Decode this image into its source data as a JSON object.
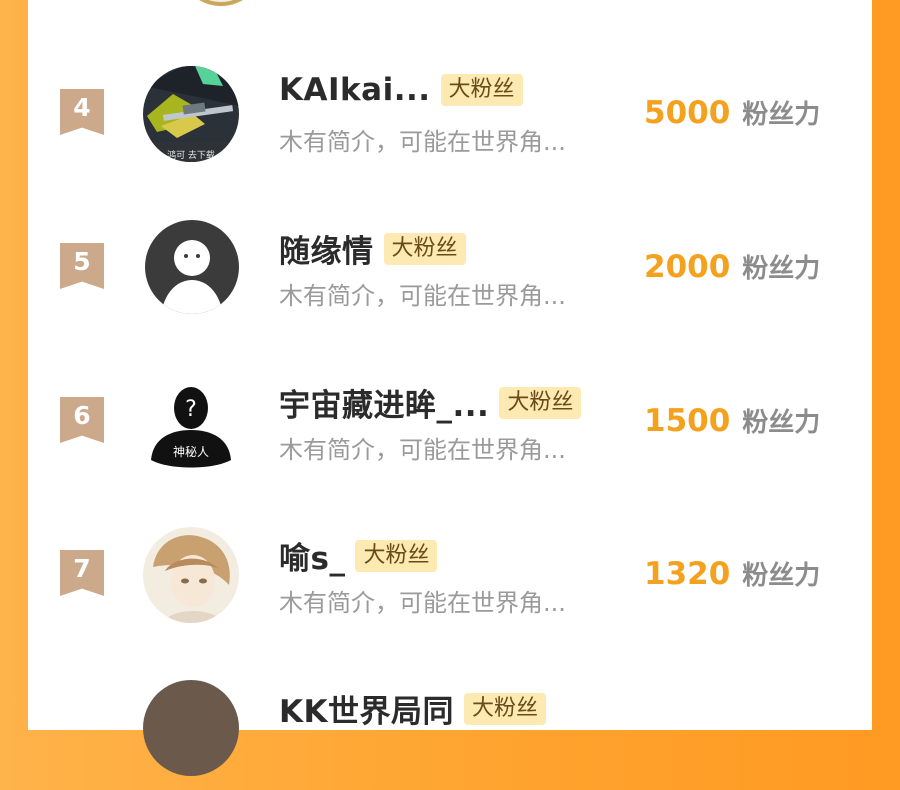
{
  "badge_color": "#fdeab2",
  "score_color": "#f4a11e",
  "rank_color": "#cda98c",
  "rows": [
    {
      "rank": "4",
      "name": "KAIkai...",
      "badge": "大粉丝",
      "bio": "木有简介，可能在世界角...",
      "score": "5000",
      "unit": "粉丝力",
      "avatar_caption": "鸿可 去下载"
    },
    {
      "rank": "5",
      "name": "随缘情",
      "badge": "大粉丝",
      "bio": "木有简介，可能在世界角...",
      "score": "2000",
      "unit": "粉丝力"
    },
    {
      "rank": "6",
      "name": "宇宙藏进眸_...",
      "badge": "大粉丝",
      "bio": "木有简介，可能在世界角...",
      "score": "1500",
      "unit": "粉丝力",
      "avatar_caption": "神秘人"
    },
    {
      "rank": "7",
      "name": "喻s_",
      "badge": "大粉丝",
      "bio": "木有简介，可能在世界角...",
      "score": "1320",
      "unit": "粉丝力"
    },
    {
      "name": "KK世界局同",
      "badge": "大粉丝"
    }
  ]
}
